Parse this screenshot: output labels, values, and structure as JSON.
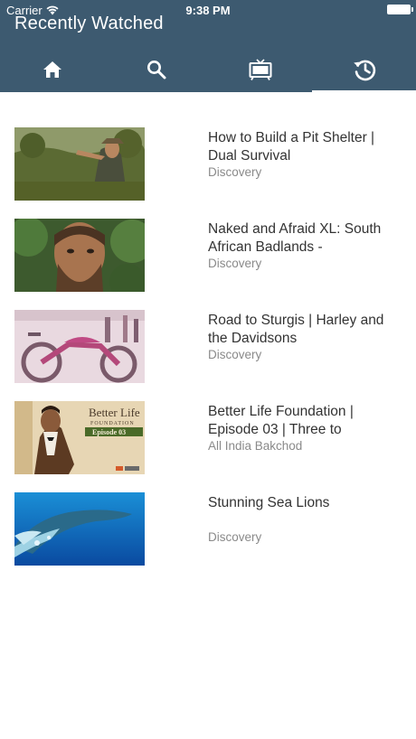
{
  "status_bar": {
    "carrier": "Carrier",
    "time": "9:38 PM",
    "icons": [
      "wifi-icon",
      "battery-icon"
    ]
  },
  "header": {
    "title": "Recently Watched",
    "background": "#3d5a70"
  },
  "tabs": [
    {
      "icon": "home-icon",
      "active": false
    },
    {
      "icon": "search-icon",
      "active": false
    },
    {
      "icon": "tv-icon",
      "active": false
    },
    {
      "icon": "history-icon",
      "active": true
    }
  ],
  "videos": [
    {
      "title": "How to Build a Pit Shelter | Dual Survival",
      "channel": "Discovery"
    },
    {
      "title": "Naked and Afraid XL: South African Badlands -",
      "channel": "Discovery"
    },
    {
      "title": "Road to Sturgis | Harley and the Davidsons",
      "channel": "Discovery"
    },
    {
      "title": "Better Life Foundation | Episode 03 | Three to",
      "channel": "All India Bakchod",
      "thumb_text": {
        "line1": "Better Life",
        "line2": "FOUNDATION",
        "badge": "Episode 03"
      }
    },
    {
      "title": "Stunning Sea Lions",
      "channel": "Discovery"
    }
  ]
}
